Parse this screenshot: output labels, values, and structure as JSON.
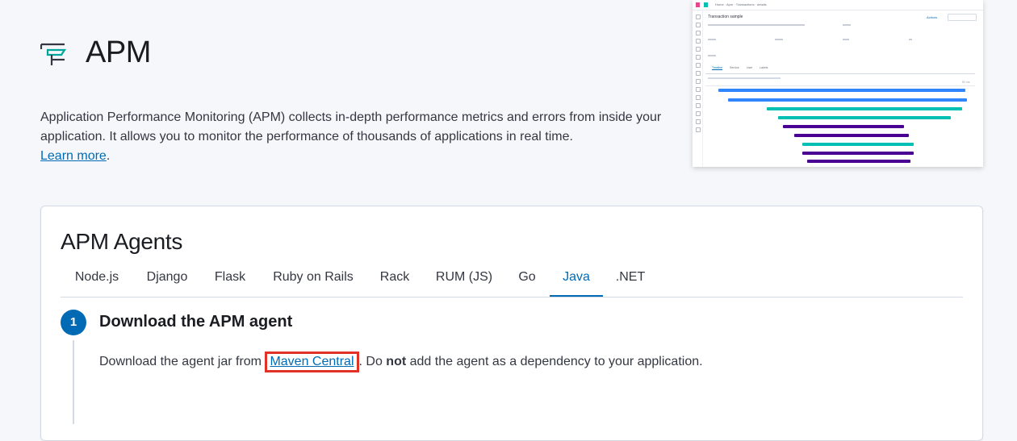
{
  "header": {
    "title": "APM",
    "icon": "apm-app-icon",
    "description": "Application Performance Monitoring (APM) collects in-depth performance metrics and errors from inside your application. It allows you to monitor the performance of thousands of applications in real time.",
    "learn_more": "Learn more",
    "after_link": "."
  },
  "preview": {
    "title": "Transaction sample",
    "actions_label": "Actions",
    "tabs": [
      "Timeline",
      "Service",
      "User",
      "Labels"
    ],
    "duration_label": "50 ms",
    "bar_colors": [
      "#3185fc",
      "#00bfb3",
      "#490092",
      "#e7664c"
    ]
  },
  "agents": {
    "title": "APM Agents",
    "tabs": [
      "Node.js",
      "Django",
      "Flask",
      "Ruby on Rails",
      "Rack",
      "RUM (JS)",
      "Go",
      "Java",
      ".NET"
    ],
    "selected_tab": "Java"
  },
  "step": {
    "number": "1",
    "title": "Download the APM agent",
    "text_before": "Download the agent jar from ",
    "link": "Maven Central",
    "text_middle": ". Do ",
    "bold": "not",
    "text_after": " add the agent as a dependency to your application."
  },
  "colors": {
    "accent": "#006bb4",
    "highlight_box": "#e03226"
  }
}
